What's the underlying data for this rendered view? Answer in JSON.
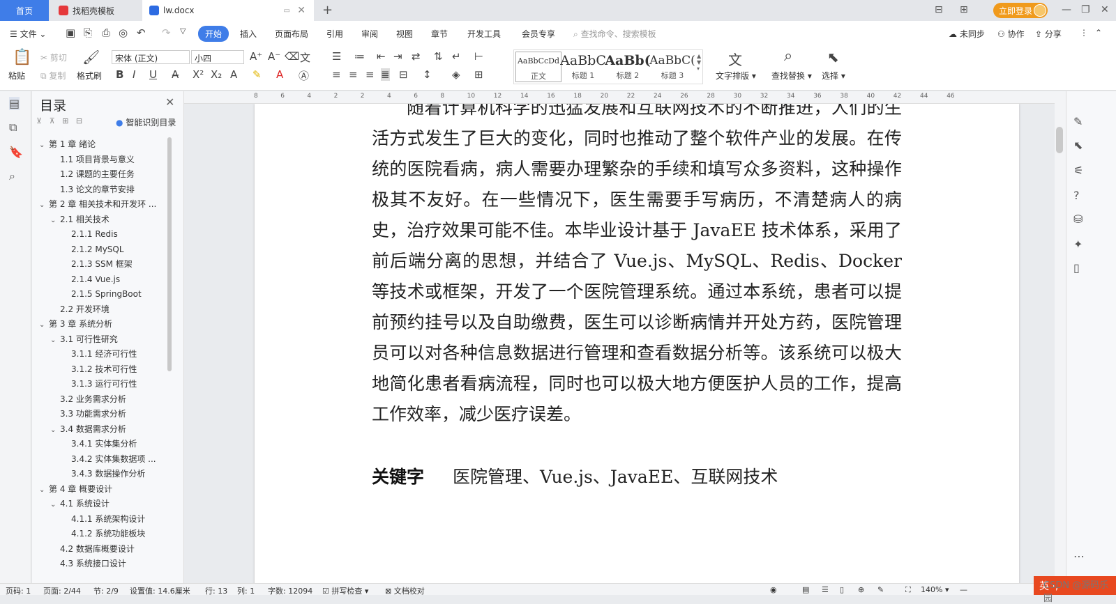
{
  "tabs": {
    "home": "首页",
    "template": "找稻壳模板",
    "doc": "lw.docx"
  },
  "titlebar": {
    "login": "立即登录"
  },
  "menu": {
    "file": "文件",
    "items": [
      "开始",
      "插入",
      "页面布局",
      "引用",
      "审阅",
      "视图",
      "章节",
      "开发工具",
      "会员专享"
    ],
    "search": "查找命令、搜索模板",
    "sync": "未同步",
    "collab": "协作",
    "share": "分享"
  },
  "ribbon": {
    "paste": "粘贴",
    "cut": "剪切",
    "copy": "复制",
    "format_painter": "格式刷",
    "font": "宋体 (正文)",
    "size": "小四",
    "styles": [
      {
        "preview": "AaBbCcDd",
        "label": "正文"
      },
      {
        "preview": "AaBbC",
        "label": "标题 1"
      },
      {
        "preview": "AaBb(",
        "label": "标题 2"
      },
      {
        "preview": "AaBbC(",
        "label": "标题 3"
      }
    ],
    "text_layout": "文字排版",
    "find_replace": "查找替换",
    "select": "选择"
  },
  "toc": {
    "title": "目录",
    "ai_label": "智能识别目录",
    "items": [
      {
        "text": "第 1 章  绪论",
        "level": 1,
        "caret": "v"
      },
      {
        "text": "1.1  项目背景与意义",
        "level": 2,
        "caret": ""
      },
      {
        "text": "1.2  课题的主要任务",
        "level": 2,
        "caret": ""
      },
      {
        "text": "1.3  论文的章节安排",
        "level": 2,
        "caret": ""
      },
      {
        "text": "第 2 章  相关技术和开发环 ...",
        "level": 1,
        "caret": "v"
      },
      {
        "text": "2.1  相关技术",
        "level": 2,
        "caret": "v"
      },
      {
        "text": "2.1.1 Redis",
        "level": 3,
        "caret": ""
      },
      {
        "text": "2.1.2 MySQL",
        "level": 3,
        "caret": ""
      },
      {
        "text": "2.1.3 SSM 框架",
        "level": 3,
        "caret": ""
      },
      {
        "text": "2.1.4 Vue.js",
        "level": 3,
        "caret": ""
      },
      {
        "text": "2.1.5 SpringBoot",
        "level": 3,
        "caret": ""
      },
      {
        "text": "2.2  开发环境",
        "level": 2,
        "caret": ""
      },
      {
        "text": "第 3 章  系统分析",
        "level": 1,
        "caret": "v"
      },
      {
        "text": "3.1  可行性研究",
        "level": 2,
        "caret": "v"
      },
      {
        "text": "3.1.1  经济可行性",
        "level": 3,
        "caret": ""
      },
      {
        "text": "3.1.2  技术可行性",
        "level": 3,
        "caret": ""
      },
      {
        "text": "3.1.3  运行可行性",
        "level": 3,
        "caret": ""
      },
      {
        "text": "3.2  业务需求分析",
        "level": 2,
        "caret": ""
      },
      {
        "text": "3.3  功能需求分析",
        "level": 2,
        "caret": ""
      },
      {
        "text": "3.4  数据需求分析",
        "level": 2,
        "caret": "v"
      },
      {
        "text": "3.4.1  实体集分析",
        "level": 3,
        "caret": ""
      },
      {
        "text": "3.4.2  实体集数据项 ...",
        "level": 3,
        "caret": ""
      },
      {
        "text": "3.4.3  数据操作分析",
        "level": 3,
        "caret": ""
      },
      {
        "text": "第 4 章  概要设计",
        "level": 1,
        "caret": "v"
      },
      {
        "text": "4.1  系统设计",
        "level": 2,
        "caret": "v"
      },
      {
        "text": "4.1.1  系统架构设计",
        "level": 3,
        "caret": ""
      },
      {
        "text": "4.1.2  系统功能板块",
        "level": 3,
        "caret": ""
      },
      {
        "text": "4.2  数据库概要设计",
        "level": 2,
        "caret": ""
      },
      {
        "text": "4.3  系统接口设计",
        "level": 2,
        "caret": ""
      }
    ]
  },
  "ruler": [
    "8",
    "6",
    "4",
    "2",
    "2",
    "4",
    "6",
    "8",
    "10",
    "12",
    "14",
    "16",
    "18",
    "20",
    "22",
    "24",
    "26",
    "28",
    "30",
    "32",
    "34",
    "36",
    "38",
    "40",
    "42",
    "44",
    "46"
  ],
  "document": {
    "paragraph": "随着计算机科学的迅猛发展和互联网技术的不断推进，人们的生活方式发生了巨大的变化，同时也推动了整个软件产业的发展。在传统的医院看病，病人需要办理繁杂的手续和填写众多资料，这种操作极其不友好。在一些情况下，医生需要手写病历，不清楚病人的病史，治疗效果可能不佳。本毕业设计基于 JavaEE 技术体系，采用了前后端分离的思想，并结合了 Vue.js、MySQL、Redis、Docker 等技术或框架，开发了一个医院管理系统。通过本系统，患者可以提前预约挂号以及自助缴费，医生可以诊断病情并开处方药，医院管理员可以对各种信息数据进行管理和查看数据分析等。该系统可以极大地简化患者看病流程，同时也可以极大地方便医护人员的工作，提高工作效率，减少医疗误差。",
    "keywords_label": "关键字",
    "keywords": "医院管理、Vue.js、JavaEE、互联网技术"
  },
  "status": {
    "page": "页码: 1",
    "pages": "页面: 2/44",
    "section": "节: 2/9",
    "setting": "设置值: 14.6厘米",
    "row": "行: 13",
    "col": "列: 1",
    "words": "字数: 12094",
    "spell": "拼写检查",
    "proof": "文档校对",
    "zoom": "140%"
  },
  "ime": "英 ·,",
  "watermark": "CSDN @源码乐园"
}
